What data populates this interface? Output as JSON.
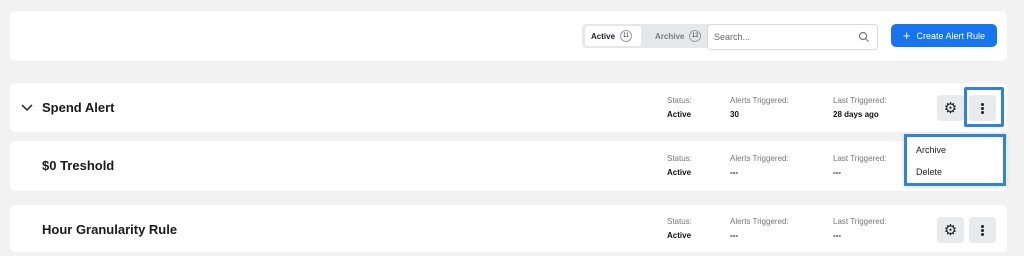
{
  "toolbar": {
    "tabs": [
      {
        "label": "Active",
        "count": "11"
      },
      {
        "label": "Archive",
        "count": "12"
      }
    ],
    "search": {
      "placeholder": "Search..."
    },
    "create_button": {
      "label": "Create Alert Rule"
    }
  },
  "alerts": [
    {
      "title": "Spend Alert",
      "status_label": "Status:",
      "status": "Active",
      "alerts_label": "Alerts Triggered:",
      "alerts": "30",
      "last_label": "Last Triggered:",
      "last": "28 days ago"
    },
    {
      "title": "$0 Treshold",
      "status_label": "Status:",
      "status": "Active",
      "alerts_label": "Alerts Triggered:",
      "alerts": "---",
      "last_label": "Last Triggered:",
      "last": "---"
    },
    {
      "title": "Hour Granularity Rule",
      "status_label": "Status:",
      "status": "Active",
      "alerts_label": "Alerts Triggered:",
      "alerts": "---",
      "last_label": "Last Triggered:",
      "last": "---"
    }
  ],
  "menu": {
    "items": [
      "Archive",
      "Delete"
    ]
  },
  "colors": {
    "accent": "#1774ef",
    "highlight": "#2f84da"
  },
  "icons": {
    "search": "search-icon",
    "settings": "gear-icon",
    "more": "vertical-ellipsis-icon",
    "expand": "chevron-down-icon",
    "create": "plus-icon"
  }
}
